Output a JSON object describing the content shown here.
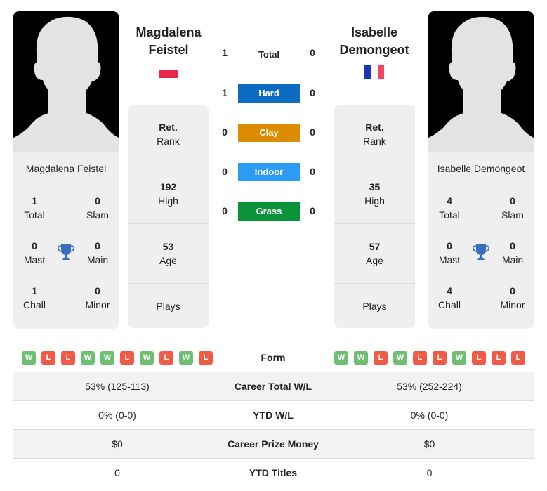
{
  "players": [
    {
      "name_line1": "Magdalena",
      "name_line2": "Feistel",
      "full_name": "Magdalena Feistel",
      "flag": "poland-flag",
      "titles": {
        "total": {
          "value": "1",
          "label": "Total"
        },
        "slam": {
          "value": "0",
          "label": "Slam"
        },
        "mast": {
          "value": "0",
          "label": "Mast"
        },
        "main": {
          "value": "0",
          "label": "Main"
        },
        "chall": {
          "value": "1",
          "label": "Chall"
        },
        "minor": {
          "value": "0",
          "label": "Minor"
        }
      },
      "rank": {
        "current": {
          "value": "Ret.",
          "label": "Rank"
        },
        "high": {
          "value": "192",
          "label": "High"
        },
        "age": {
          "value": "53",
          "label": "Age"
        },
        "plays": {
          "value": "",
          "label": "Plays"
        }
      },
      "form": [
        "W",
        "L",
        "L",
        "W",
        "W",
        "L",
        "W",
        "L",
        "W",
        "L"
      ]
    },
    {
      "name_line1": "Isabelle",
      "name_line2": "Demongeot",
      "full_name": "Isabelle Demongeot",
      "flag": "france-flag",
      "titles": {
        "total": {
          "value": "4",
          "label": "Total"
        },
        "slam": {
          "value": "0",
          "label": "Slam"
        },
        "mast": {
          "value": "0",
          "label": "Mast"
        },
        "main": {
          "value": "0",
          "label": "Main"
        },
        "chall": {
          "value": "4",
          "label": "Chall"
        },
        "minor": {
          "value": "0",
          "label": "Minor"
        }
      },
      "rank": {
        "current": {
          "value": "Ret.",
          "label": "Rank"
        },
        "high": {
          "value": "35",
          "label": "High"
        },
        "age": {
          "value": "57",
          "label": "Age"
        },
        "plays": {
          "value": "",
          "label": "Plays"
        }
      },
      "form": [
        "W",
        "W",
        "L",
        "W",
        "L",
        "L",
        "W",
        "L",
        "L",
        "L"
      ]
    }
  ],
  "h2h": [
    {
      "label": "Total",
      "left": "1",
      "right": "0",
      "color": ""
    },
    {
      "label": "Hard",
      "left": "1",
      "right": "0",
      "color": "#0b6cc2"
    },
    {
      "label": "Clay",
      "left": "0",
      "right": "0",
      "color": "#db8c00"
    },
    {
      "label": "Indoor",
      "left": "0",
      "right": "0",
      "color": "#2b9bf4"
    },
    {
      "label": "Grass",
      "left": "0",
      "right": "0",
      "color": "#0a9338"
    }
  ],
  "table": {
    "form_label": "Form",
    "rows": [
      {
        "label": "Career Total W/L",
        "left": "53% (125-113)",
        "right": "53% (252-224)"
      },
      {
        "label": "YTD W/L",
        "left": "0% (0-0)",
        "right": "0% (0-0)"
      },
      {
        "label": "Career Prize Money",
        "left": "$0",
        "right": "$0"
      },
      {
        "label": "YTD Titles",
        "left": "0",
        "right": "0"
      }
    ]
  },
  "colors": {
    "win": "#6fbf73",
    "loss": "#ef5b45",
    "trophy": "#3a6fc0",
    "poland_red": "#e8274b",
    "france_blue": "#1737b8",
    "france_red": "#f0475c"
  }
}
